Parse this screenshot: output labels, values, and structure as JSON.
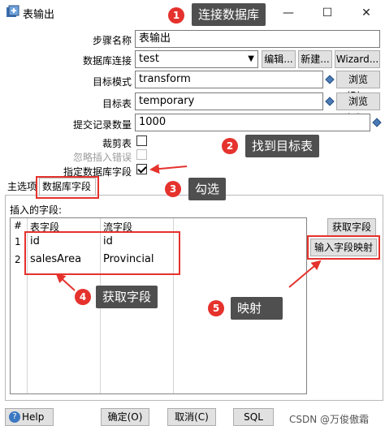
{
  "window": {
    "title": "表输出",
    "minimize_glyph": "—",
    "maximize_glyph": "☐",
    "close_glyph": "✕"
  },
  "form": {
    "step_name_label": "步骤名称",
    "step_name_value": "表输出",
    "db_conn_label": "数据库连接",
    "db_conn_value": "test",
    "edit_button": "编辑...",
    "new_button": "新建...",
    "wizard_button": "Wizard...",
    "schema_label": "目标模式",
    "schema_value": "transform",
    "browse_schema_button": "浏览(B)...",
    "table_label": "目标表",
    "table_value": "temporary",
    "browse_table_button": "浏览(B)...",
    "commit_size_label": "提交记录数量",
    "commit_size_value": "1000",
    "truncate_label": "裁剪表",
    "ignore_errors_label": "忽略插入错误",
    "specify_fields_label": "指定数据库字段",
    "specify_fields_checked": true
  },
  "tabs": [
    {
      "label": "主选项",
      "active": false
    },
    {
      "label": "数据库字段",
      "active": true
    }
  ],
  "fields_panel": {
    "title": "插入的字段:",
    "columns": [
      "#",
      "表字段",
      "流字段"
    ],
    "rows": [
      {
        "num": "1",
        "table_field": "id",
        "stream_field": "id"
      },
      {
        "num": "2",
        "table_field": "salesArea",
        "stream_field": "Provincial"
      }
    ],
    "get_fields_button": "获取字段",
    "map_fields_button": "输入字段映射"
  },
  "bottom": {
    "help_button": "Help",
    "ok_button": "确定(O)",
    "cancel_button": "取消(C)",
    "sql_button": "SQL"
  },
  "annotations": [
    {
      "num": "1",
      "text": "连接数据库"
    },
    {
      "num": "2",
      "text": "找到目标表"
    },
    {
      "num": "3",
      "text": "勾选"
    },
    {
      "num": "4",
      "text": "获取字段"
    },
    {
      "num": "5",
      "text": "映射"
    }
  ],
  "watermark": "CSDN @万俊傲霜",
  "colors": {
    "callout_bg": "#4f4f4f",
    "callout_number_bg": "#e5322d",
    "highlight_box": "#e5322d"
  }
}
